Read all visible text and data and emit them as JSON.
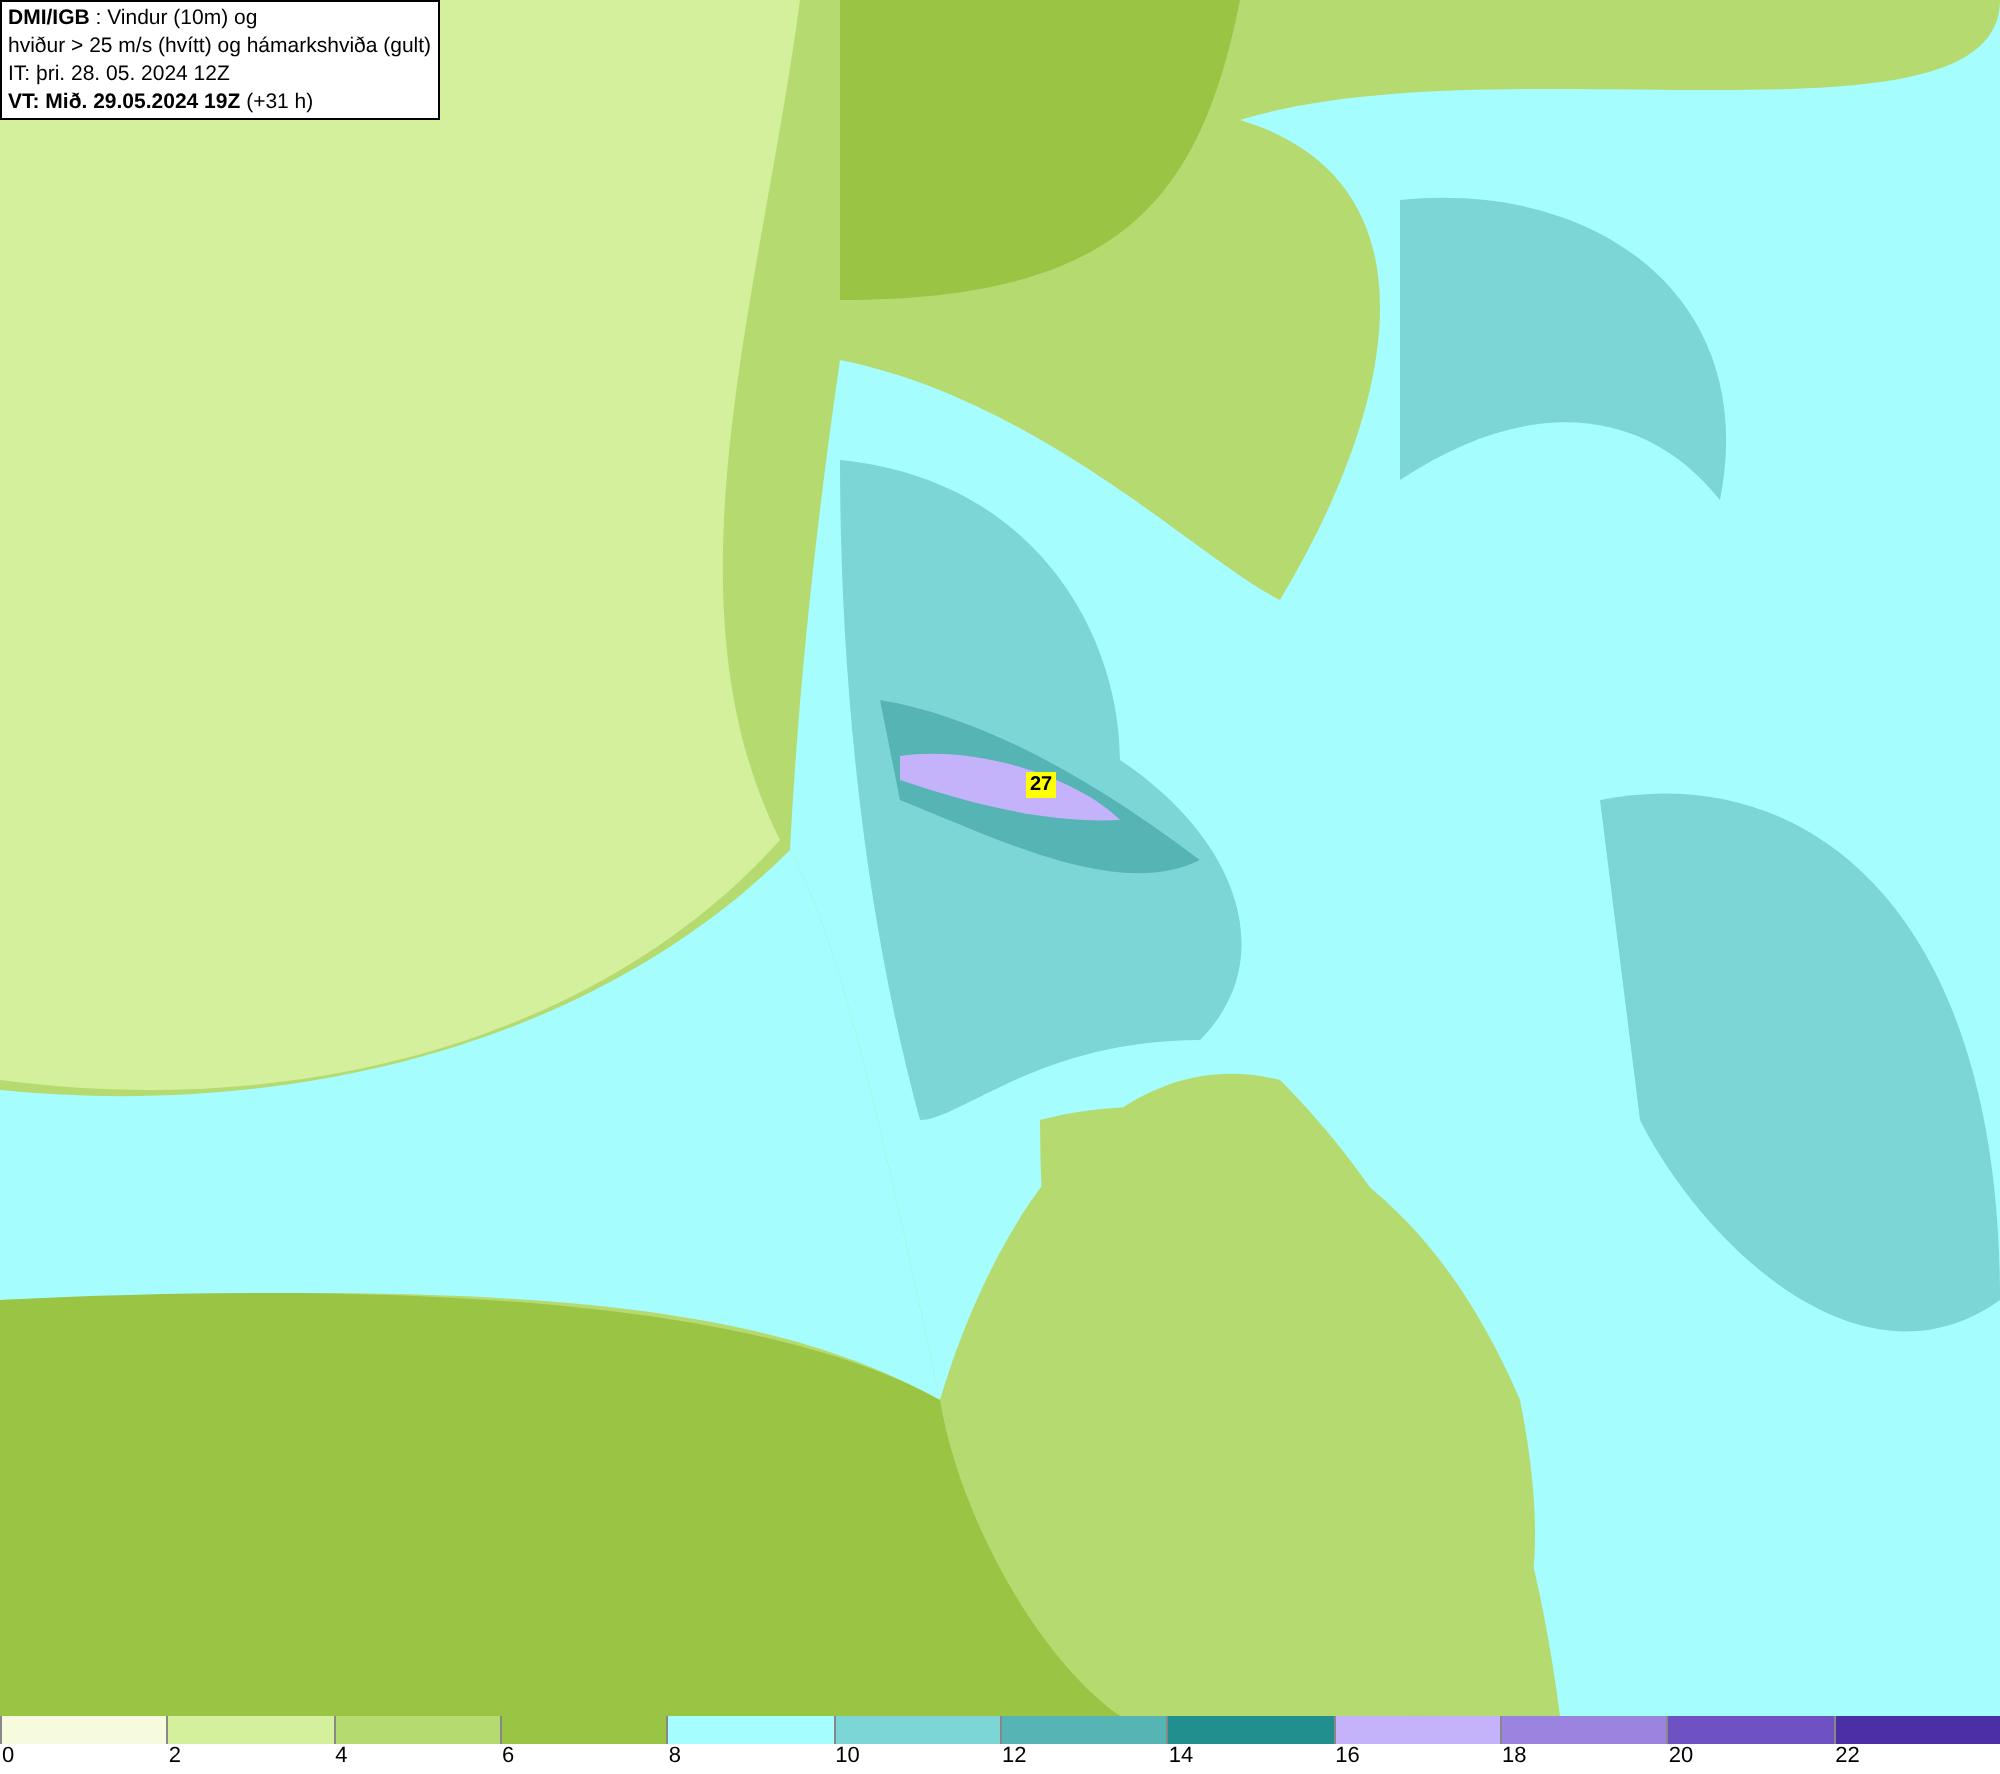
{
  "info_box": {
    "lines": [
      "**DMI/IGB** : Vindur (10m) og",
      "hviður > 25 m/s (hvítt) og hámarkshviða (gult)",
      "IT: þri. 28. 05. 2024 12Z",
      "**VT: Mið. 29.05.2024 19Z** (+31 h)"
    ]
  },
  "map": {
    "max_gust_label": "27"
  },
  "legend": {
    "bins": [
      {
        "color": "#f5fbdc"
      },
      {
        "color": "#d4f09c"
      },
      {
        "color": "#b5da70"
      },
      {
        "color": "#99c444"
      },
      {
        "color": "#a6fdfd"
      },
      {
        "color": "#7dd6d6"
      },
      {
        "color": "#56b4b4"
      },
      {
        "color": "#228f8f"
      },
      {
        "color": "#c4b3fb"
      },
      {
        "color": "#9b83e0"
      },
      {
        "color": "#6e52c4"
      },
      {
        "color": "#4a2fa6"
      }
    ],
    "ticks": [
      "0",
      "2",
      "4",
      "6",
      "8",
      "10",
      "12",
      "14",
      "16",
      "18",
      "20",
      "22"
    ]
  }
}
